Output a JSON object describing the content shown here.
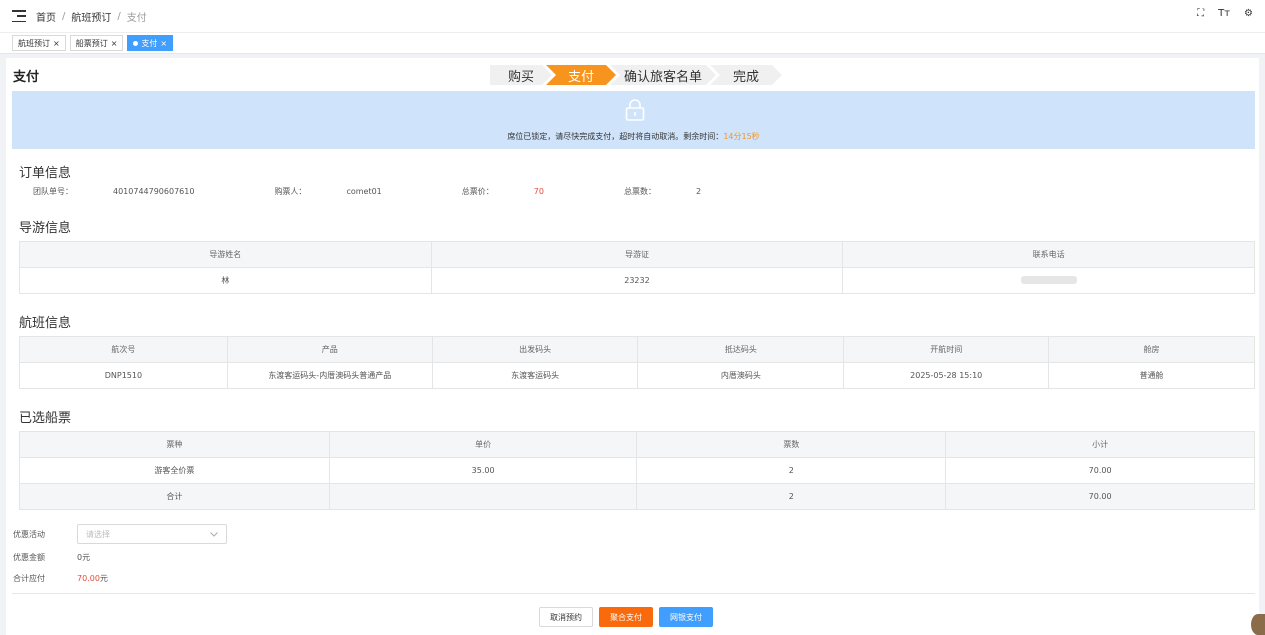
{
  "breadcrumb": {
    "home": "首页",
    "parent": "航班预订",
    "current": "支付",
    "sep": "/"
  },
  "topbar_icons": {
    "fullscreen": "⛶",
    "font": "Tт",
    "settings": "⚙"
  },
  "tabs": [
    {
      "label": "航班预订",
      "close": "×"
    },
    {
      "label": "船票预订",
      "close": "×"
    },
    {
      "label": "支付",
      "close": "×"
    }
  ],
  "page_title": "支付",
  "steps": [
    "购买",
    "支付",
    "确认旅客名单",
    "完成"
  ],
  "banner": {
    "message": "席位已锁定，请尽快完成支付，超时将自动取消。剩余时间：",
    "time": "14分15秒"
  },
  "sections": {
    "order": "订单信息",
    "guide": "导游信息",
    "flight": "航班信息",
    "tickets": "已选船票"
  },
  "order": {
    "group_no_label": "团队单号：",
    "group_no": "4010744790607610",
    "buyer_label": "购票人：",
    "buyer": "comet01",
    "total_price_label": "总票价：",
    "total_price": "70",
    "total_count_label": "总票数：",
    "total_count": "2"
  },
  "guide_table": {
    "headers": [
      "导游姓名",
      "导游证",
      "联系电话"
    ],
    "row": [
      "林",
      "23232",
      ""
    ]
  },
  "flight_table": {
    "headers": [
      "航次号",
      "产品",
      "出发码头",
      "抵达码头",
      "开航时间",
      "舱房"
    ],
    "row": [
      "DNP1510",
      "东渡客运码头-内厝澳码头普通产品",
      "东渡客运码头",
      "内厝澳码头",
      "2025-05-28 15:10",
      "普通舱"
    ]
  },
  "ticket_table": {
    "headers": [
      "票种",
      "单价",
      "票数",
      "小计"
    ],
    "row": [
      "游客全价票",
      "35.00",
      "2",
      "70.00"
    ],
    "sum": [
      "合计",
      "",
      "2",
      "70.00"
    ]
  },
  "form": {
    "promo_label": "优惠活动",
    "promo_placeholder": "请选择",
    "discount_label": "优惠金额",
    "discount_value": "0元",
    "payable_label": "合计应付",
    "payable_amount": "70.00",
    "payable_unit": "元"
  },
  "actions": {
    "cancel": "取消预约",
    "aggregate_pay": "聚合支付",
    "bank_pay": "网银支付"
  },
  "colors": {
    "accent": "#f7941d",
    "primary": "#409eff",
    "danger": "#e74c3c",
    "banner_bg": "#cfe4fb"
  }
}
